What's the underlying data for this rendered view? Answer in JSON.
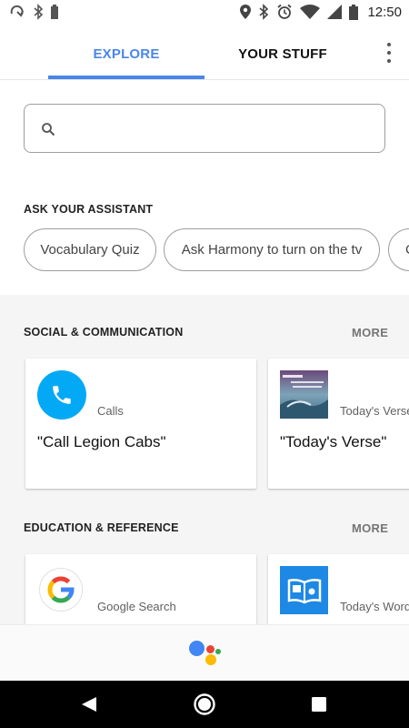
{
  "status_bar": {
    "time": "12:50",
    "left_icons": [
      "sync-icon",
      "bluetooth-icon",
      "battery-small-icon"
    ],
    "right_icons": [
      "location-icon",
      "bluetooth-icon",
      "alarm-icon",
      "wifi-icon",
      "signal-icon",
      "battery-icon"
    ]
  },
  "tabs": {
    "explore": "EXPLORE",
    "your_stuff": "YOUR STUFF",
    "active": "explore",
    "overflow_icon": "more-vert-icon"
  },
  "search": {
    "value": "",
    "placeholder": "",
    "icon": "search-icon"
  },
  "ask": {
    "title": "ASK YOUR ASSISTANT",
    "chips": [
      "Vocabulary Quiz",
      "Ask Harmony to turn on the tv",
      "C"
    ]
  },
  "sections": [
    {
      "title": "SOCIAL & COMMUNICATION",
      "more": "MORE",
      "cards": [
        {
          "category": "Calls",
          "title": "\"Call Legion Cabs\"",
          "icon": "phone-icon"
        },
        {
          "category": "Today's Verse",
          "title": "\"Today's Verse\"",
          "icon": "verse-thumbnail"
        }
      ]
    },
    {
      "title": "EDUCATION & REFERENCE",
      "more": "MORE",
      "cards": [
        {
          "category": "Google Search",
          "title": "",
          "icon": "google-logo-icon"
        },
        {
          "category": "Today's Word",
          "title": "",
          "icon": "dictionary-book-icon"
        }
      ]
    }
  ],
  "colors": {
    "accent": "#4a86e8",
    "calls": "#03a9f4",
    "assistant_dots": [
      "#4285f4",
      "#ea4335",
      "#fbbc05",
      "#34a853"
    ]
  },
  "nav": {
    "back": "back-icon",
    "home": "home-icon",
    "recents": "recents-icon"
  }
}
